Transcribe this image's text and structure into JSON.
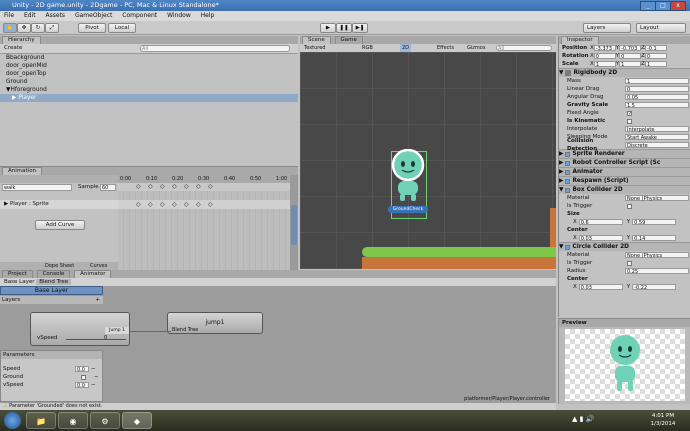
{
  "window": {
    "title": "Unity - 2D game.unity - 2Dgame - PC, Mac & Linux Standalone*"
  },
  "menu": [
    "File",
    "Edit",
    "Assets",
    "GameObject",
    "Component",
    "Window",
    "Help"
  ],
  "toolbar": {
    "pivot": "Pivot",
    "local": "Local",
    "layers": "Layers",
    "layout": "Layout"
  },
  "hierarchy": {
    "tab": "Hierarchy",
    "create": "Create",
    "search_placeholder": "All",
    "items": [
      "Bbackground",
      "door_openMid",
      "door_openTop",
      "Ground",
      "Hforeground",
      "Player"
    ]
  },
  "animation": {
    "tab": "Animation",
    "clip": "walk",
    "sample_label": "Sample",
    "sample": "60",
    "times": [
      "0:00",
      "0:10",
      "0:20",
      "0:30",
      "0:40",
      "0:50",
      "1:00"
    ],
    "track": "Player : Sprite",
    "add_curve": "Add Curve",
    "dope_sheet": "Dope Sheet",
    "curves": "Curves"
  },
  "scene": {
    "tab_scene": "Scene",
    "tab_game": "Game",
    "textured": "Textured",
    "rgb": "RGB",
    "mode2d": "2D",
    "effects": "Effects",
    "gizmos": "Gizmos",
    "search_placeholder": "All",
    "label": "GroundCheck"
  },
  "bottom_tabs": [
    "Project",
    "Console",
    "Animator"
  ],
  "animator": {
    "breadcrumb": [
      "Base Layer",
      "Blend Tree"
    ],
    "base_layer": "Base Layer",
    "layers_label": "Layers",
    "vspeed_label": "vSpeed",
    "vspeed_value": "0",
    "jump_node": "jump1",
    "jump_port": "Jump 1",
    "blend_node": "Blend Tree",
    "params_title": "Parameters",
    "params": [
      {
        "name": "Speed",
        "value": "0.0"
      },
      {
        "name": "Ground",
        "value": ""
      },
      {
        "name": "vSpeed",
        "value": "0.0"
      }
    ],
    "path": "platformer/Player/Player.controller"
  },
  "inspector": {
    "tab": "Inspector",
    "position": {
      "label": "Position",
      "x": "-3.373",
      "y": "-0.703",
      "z": "-0.1"
    },
    "rotation": {
      "label": "Rotation",
      "x": "0",
      "y": "0",
      "z": "0"
    },
    "scale": {
      "label": "Scale",
      "x": "1",
      "y": "1",
      "z": "1"
    },
    "rigidbody": {
      "title": "Rigidbody 2D",
      "rows": [
        {
          "label": "Mass",
          "value": "1"
        },
        {
          "label": "Linear Drag",
          "value": "0"
        },
        {
          "label": "Angular Drag",
          "value": "0.05"
        },
        {
          "label": "Gravity Scale",
          "value": "1.5"
        },
        {
          "label": "Fixed Angle",
          "value": "✓"
        },
        {
          "label": "Is Kinematic",
          "value": ""
        },
        {
          "label": "Interpolate",
          "value": "Interpolate"
        },
        {
          "label": "Sleeping Mode",
          "value": "Start Awake"
        },
        {
          "label": "Collision Detection",
          "value": "Discrete"
        }
      ]
    },
    "components": [
      "Sprite Renderer",
      "Robot Controller Script (Sc",
      "Animator",
      "Respawn (Script)"
    ],
    "box_collider": {
      "title": "Box Collider 2D",
      "material_label": "Material",
      "material": "None (Physics",
      "trigger_label": "Is Trigger",
      "size_label": "Size",
      "size_x": "0.6",
      "size_y": "0.59",
      "center_label": "Center",
      "center_x": "0.03",
      "center_y": "0.14"
    },
    "circle_collider": {
      "title": "Circle Collider 2D",
      "material_label": "Material",
      "material": "None (Physics",
      "trigger_label": "Is Trigger",
      "radius_label": "Radius",
      "radius": "0.25",
      "center_label": "Center",
      "center_x": "0.03",
      "center_y": "-0.22"
    },
    "preview": "Preview"
  },
  "status": {
    "message": "Parameter 'Grounded' does not exist."
  },
  "taskbar": {
    "time": "4:01 PM",
    "date": "1/3/2014"
  },
  "colors": {
    "accent": "#3a72b8",
    "ground": "#7fc74a",
    "dirt": "#c7753a",
    "robot": "#6fd1b6"
  }
}
